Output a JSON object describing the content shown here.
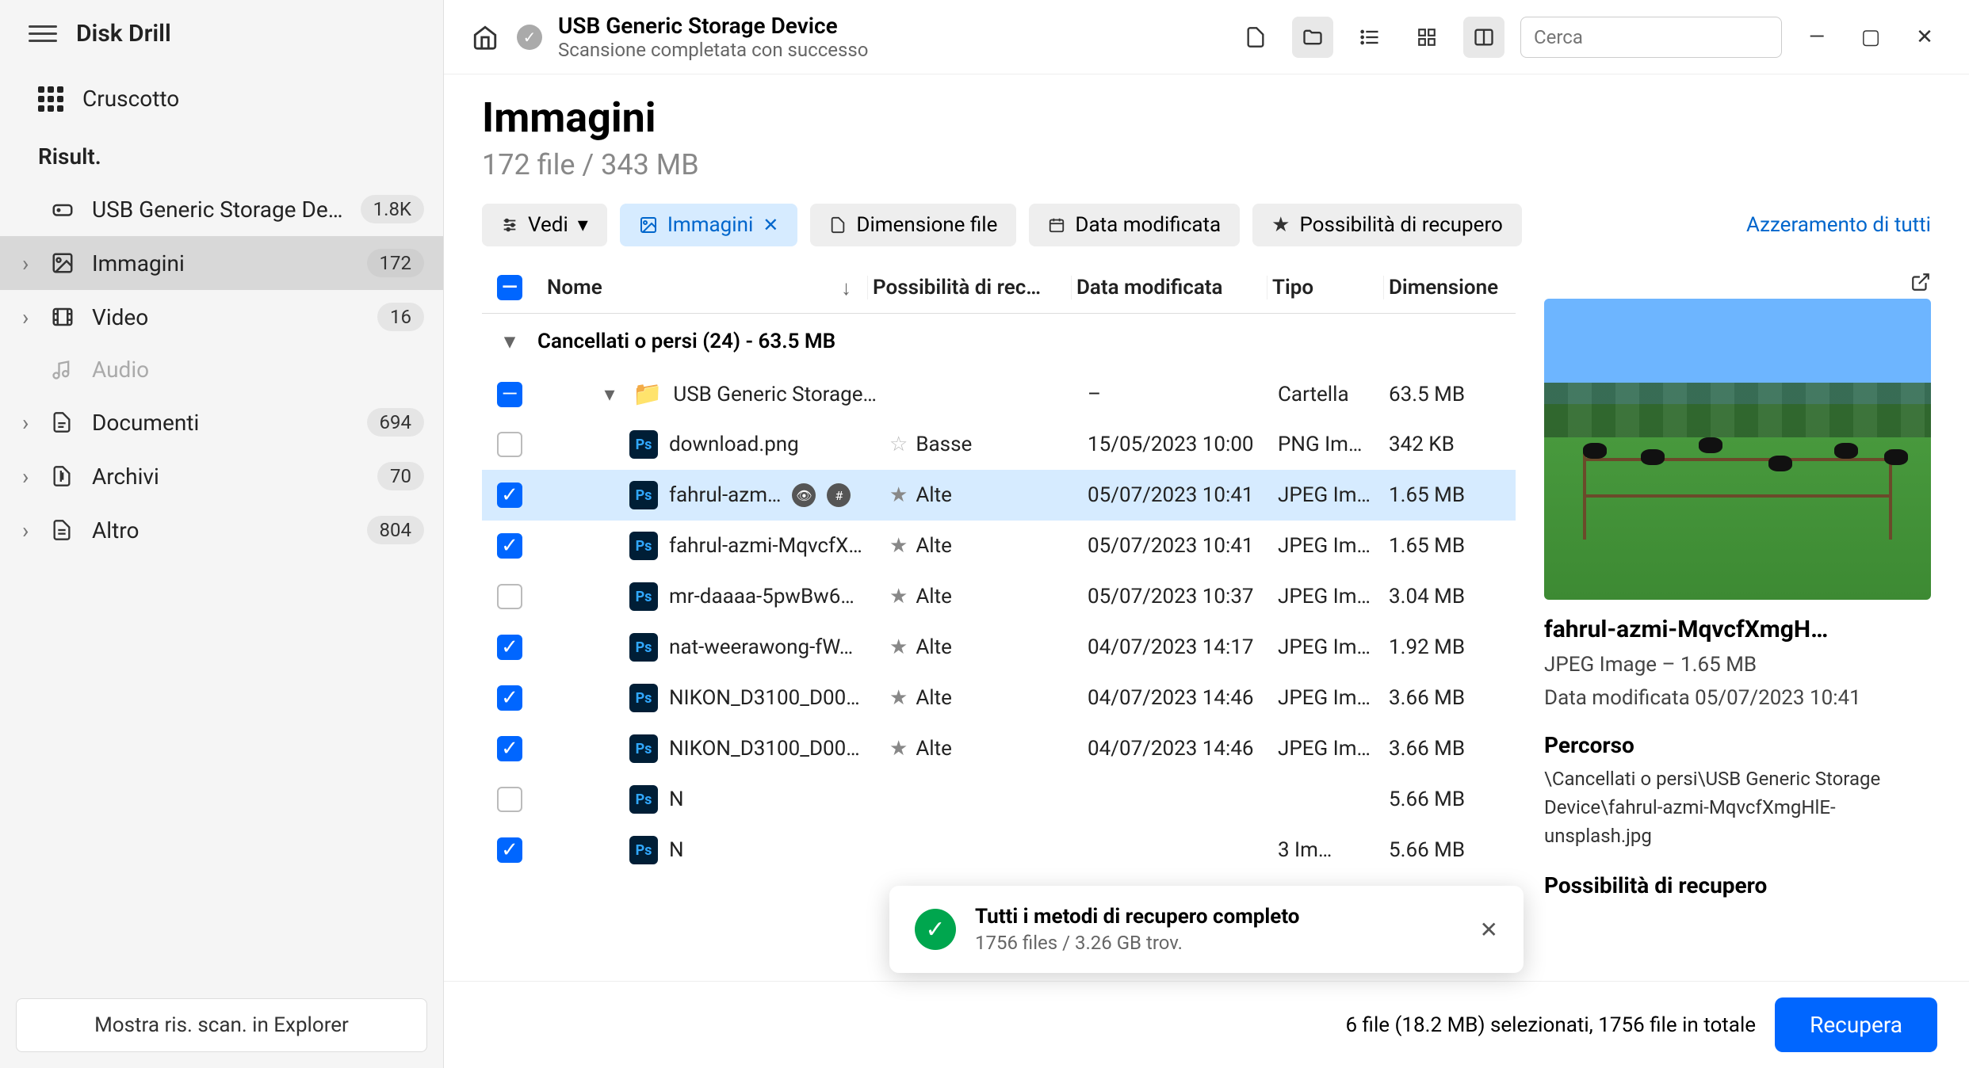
{
  "app": {
    "title": "Disk Drill"
  },
  "sidebar": {
    "dashboard": "Cruscotto",
    "section_label": "Risult.",
    "items": [
      {
        "label": "USB Generic Storage De…",
        "badge": "1.8K",
        "icon": "drive",
        "expandable": false
      },
      {
        "label": "Immagini",
        "badge": "172",
        "icon": "image",
        "expandable": true,
        "active": true
      },
      {
        "label": "Video",
        "badge": "16",
        "icon": "video",
        "expandable": true
      },
      {
        "label": "Audio",
        "badge": "",
        "icon": "audio",
        "expandable": false,
        "muted": true
      },
      {
        "label": "Documenti",
        "badge": "694",
        "icon": "doc",
        "expandable": true
      },
      {
        "label": "Archivi",
        "badge": "70",
        "icon": "archive",
        "expandable": true
      },
      {
        "label": "Altro",
        "badge": "804",
        "icon": "other",
        "expandable": true
      }
    ],
    "footer_button": "Mostra ris. scan. in Explorer"
  },
  "topbar": {
    "title": "USB Generic Storage Device",
    "subtitle": "Scansione completata con successo",
    "search_placeholder": "Cerca"
  },
  "page": {
    "heading": "Immagini",
    "subheading": "172 file / 343 MB"
  },
  "filters": {
    "view": "Vedi",
    "img": "Immagini",
    "size": "Dimensione file",
    "date": "Data modificata",
    "chance": "Possibilità di recupero",
    "reset": "Azzeramento di tutti"
  },
  "columns": {
    "name": "Nome",
    "recovery": "Possibilità di rec…",
    "date": "Data modificata",
    "type": "Tipo",
    "size": "Dimensione"
  },
  "section": {
    "label": "Cancellati o persi (24) - 63.5 MB"
  },
  "folder_row": {
    "name": "USB Generic Storage…",
    "date": "–",
    "type": "Cartella",
    "size": "63.5 MB"
  },
  "rows": [
    {
      "checked": false,
      "name": "download.png",
      "eye": false,
      "rec": "Basse",
      "rec_outline": true,
      "date": "15/05/2023 10:00",
      "type": "PNG Im…",
      "size": "342 KB"
    },
    {
      "checked": true,
      "selected": true,
      "name": "fahrul-azm…",
      "eye": true,
      "rec": "Alte",
      "date": "05/07/2023 10:41",
      "type": "JPEG Im…",
      "size": "1.65 MB"
    },
    {
      "checked": true,
      "name": "fahrul-azmi-MqvcfX…",
      "rec": "Alte",
      "date": "05/07/2023 10:41",
      "type": "JPEG Im…",
      "size": "1.65 MB"
    },
    {
      "checked": false,
      "name": "mr-daaaa-5pwBw6…",
      "rec": "Alte",
      "date": "05/07/2023 10:37",
      "type": "JPEG Im…",
      "size": "3.04 MB"
    },
    {
      "checked": true,
      "name": "nat-weerawong-fW…",
      "rec": "Alte",
      "date": "04/07/2023 14:17",
      "type": "JPEG Im…",
      "size": "1.92 MB"
    },
    {
      "checked": true,
      "name": "NIKON_D3100_D00…",
      "rec": "Alte",
      "date": "04/07/2023 14:46",
      "type": "JPEG Im…",
      "size": "3.66 MB"
    },
    {
      "checked": true,
      "name": "NIKON_D3100_D00…",
      "rec": "Alte",
      "date": "04/07/2023 14:46",
      "type": "JPEG Im…",
      "size": "3.66 MB"
    },
    {
      "checked": false,
      "name": "N",
      "rec": "",
      "date": "",
      "type": "",
      "size": "5.66 MB"
    },
    {
      "checked": true,
      "name": "N",
      "rec": "",
      "date": "",
      "type": "3 Im…",
      "size": "5.66 MB"
    }
  ],
  "preview": {
    "filename": "fahrul-azmi-MqvcfXmgH…",
    "meta1": "JPEG Image – 1.65 MB",
    "meta2": "Data modificata 05/07/2023 10:41",
    "path_label": "Percorso",
    "path": "\\Cancellati o persi\\USB Generic Storage Device\\fahrul-azmi-MqvcfXmgHlE-unsplash.jpg",
    "rec_label": "Possibilità di recupero"
  },
  "toast": {
    "title": "Tutti i metodi di recupero completo",
    "sub": "1756 files / 3.26 GB trov."
  },
  "bottom": {
    "status": "6 file (18.2 MB) selezionati, 1756 file in totale",
    "recover": "Recupera"
  }
}
